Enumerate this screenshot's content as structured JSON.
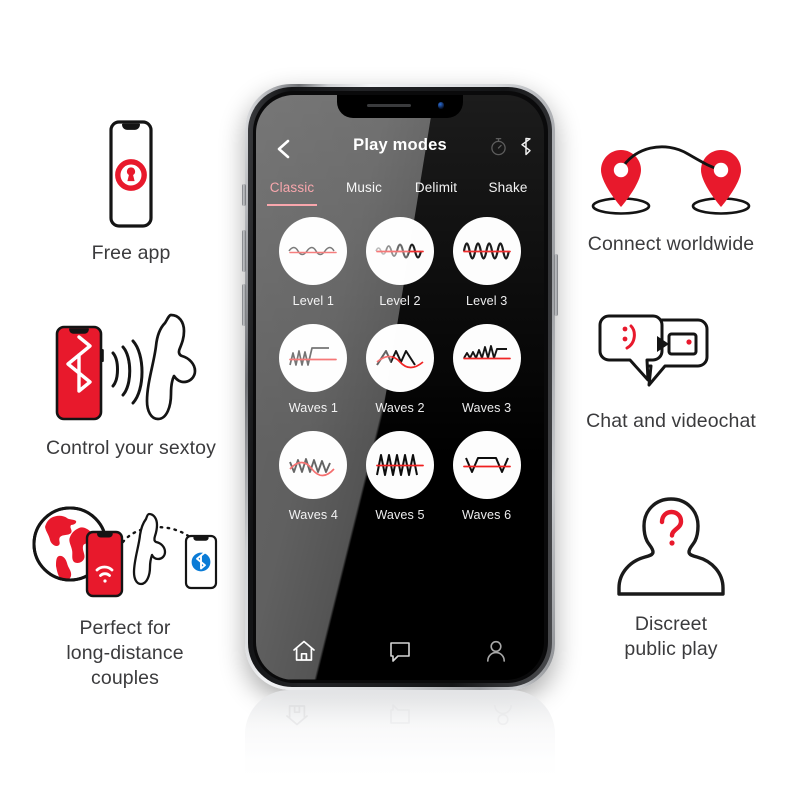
{
  "features": {
    "left": [
      {
        "id": "free-app",
        "caption": "Free app",
        "icon": "phone-with-lock-icon"
      },
      {
        "id": "control",
        "caption": "Control your sextoy",
        "icon": "phone-bluetooth-toy-icon"
      },
      {
        "id": "distance",
        "caption": "Perfect for\nlong-distance\ncouples",
        "icon": "globe-phone-toy-icon"
      }
    ],
    "right": [
      {
        "id": "connect",
        "caption": "Connect worldwide",
        "icon": "two-map-pins-icon"
      },
      {
        "id": "chat",
        "caption": "Chat and videochat",
        "icon": "speech-bubbles-video-icon"
      },
      {
        "id": "discreet",
        "caption": "Discreet\npublic play",
        "icon": "anonymous-person-icon"
      }
    ]
  },
  "phone": {
    "appbar": {
      "back_label": "‹",
      "title": "Play modes",
      "icons": [
        {
          "name": "timer-icon",
          "state": "dim"
        },
        {
          "name": "bluetooth-icon",
          "state": "active"
        }
      ]
    },
    "tabs": [
      {
        "label": "Classic",
        "active": true
      },
      {
        "label": "Music",
        "active": false
      },
      {
        "label": "Delimit",
        "active": false
      },
      {
        "label": "Shake",
        "active": false
      }
    ],
    "modes": [
      {
        "label": "Level 1",
        "wave": "sine-low-amplitude"
      },
      {
        "label": "Level 2",
        "wave": "sine-medium-growing"
      },
      {
        "label": "Level 3",
        "wave": "sine-high-frequency"
      },
      {
        "label": "Waves 1",
        "wave": "zigzag-then-flat"
      },
      {
        "label": "Waves 2",
        "wave": "wide-triangle-dip"
      },
      {
        "label": "Waves 3",
        "wave": "small-then-large-zigzag"
      },
      {
        "label": "Waves 4",
        "wave": "descending-zigzag-arc"
      },
      {
        "label": "Waves 5",
        "wave": "sharp-triangle-train"
      },
      {
        "label": "Waves 6",
        "wave": "v-plateau-v"
      }
    ],
    "navbar": [
      {
        "name": "home-icon",
        "active": true
      },
      {
        "name": "chat-icon",
        "active": false
      },
      {
        "name": "profile-icon",
        "active": false
      }
    ]
  },
  "colors": {
    "brand_red": "#e8192c",
    "accent_pink": "#f4626d",
    "wave_red": "#f02020",
    "caption_text": "#3b3b3d",
    "screen_bg": "#000000"
  }
}
